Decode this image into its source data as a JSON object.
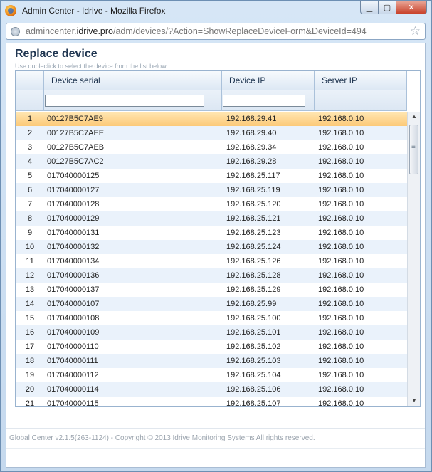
{
  "window": {
    "title": "Admin Center - Idrive - Mozilla Firefox"
  },
  "urlbar": {
    "host_prefix": "admincenter.",
    "host_main": "idrive.pro",
    "path": "/adm/devices/?Action=ShowReplaceDeviceForm&DeviceId=494"
  },
  "page": {
    "title": "Replace device",
    "hint": "Use dubleclick to select the device from the list below"
  },
  "grid": {
    "columns": [
      "",
      "Device serial",
      "Device IP",
      "Server IP"
    ],
    "rows": [
      [
        "1",
        "00127B5C7AE9",
        "192.168.29.41",
        "192.168.0.10"
      ],
      [
        "2",
        "00127B5C7AEE",
        "192.168.29.40",
        "192.168.0.10"
      ],
      [
        "3",
        "00127B5C7AEB",
        "192.168.29.34",
        "192.168.0.10"
      ],
      [
        "4",
        "00127B5C7AC2",
        "192.168.29.28",
        "192.168.0.10"
      ],
      [
        "5",
        "017040000125",
        "192.168.25.117",
        "192.168.0.10"
      ],
      [
        "6",
        "017040000127",
        "192.168.25.119",
        "192.168.0.10"
      ],
      [
        "7",
        "017040000128",
        "192.168.25.120",
        "192.168.0.10"
      ],
      [
        "8",
        "017040000129",
        "192.168.25.121",
        "192.168.0.10"
      ],
      [
        "9",
        "017040000131",
        "192.168.25.123",
        "192.168.0.10"
      ],
      [
        "10",
        "017040000132",
        "192.168.25.124",
        "192.168.0.10"
      ],
      [
        "11",
        "017040000134",
        "192.168.25.126",
        "192.168.0.10"
      ],
      [
        "12",
        "017040000136",
        "192.168.25.128",
        "192.168.0.10"
      ],
      [
        "13",
        "017040000137",
        "192.168.25.129",
        "192.168.0.10"
      ],
      [
        "14",
        "017040000107",
        "192.168.25.99",
        "192.168.0.10"
      ],
      [
        "15",
        "017040000108",
        "192.168.25.100",
        "192.168.0.10"
      ],
      [
        "16",
        "017040000109",
        "192.168.25.101",
        "192.168.0.10"
      ],
      [
        "17",
        "017040000110",
        "192.168.25.102",
        "192.168.0.10"
      ],
      [
        "18",
        "017040000111",
        "192.168.25.103",
        "192.168.0.10"
      ],
      [
        "19",
        "017040000112",
        "192.168.25.104",
        "192.168.0.10"
      ],
      [
        "20",
        "017040000114",
        "192.168.25.106",
        "192.168.0.10"
      ],
      [
        "21",
        "017040000115",
        "192.168.25.107",
        "192.168.0.10"
      ]
    ],
    "selected_row": 0
  },
  "footer": {
    "text": "Global Center v2.1.5(263-1124) - Copyright © 2013 Idrive Monitoring Systems All rights reserved."
  },
  "icons": {
    "app": "firefox-icon",
    "site": "globe-icon",
    "bookmark": "star-icon"
  }
}
